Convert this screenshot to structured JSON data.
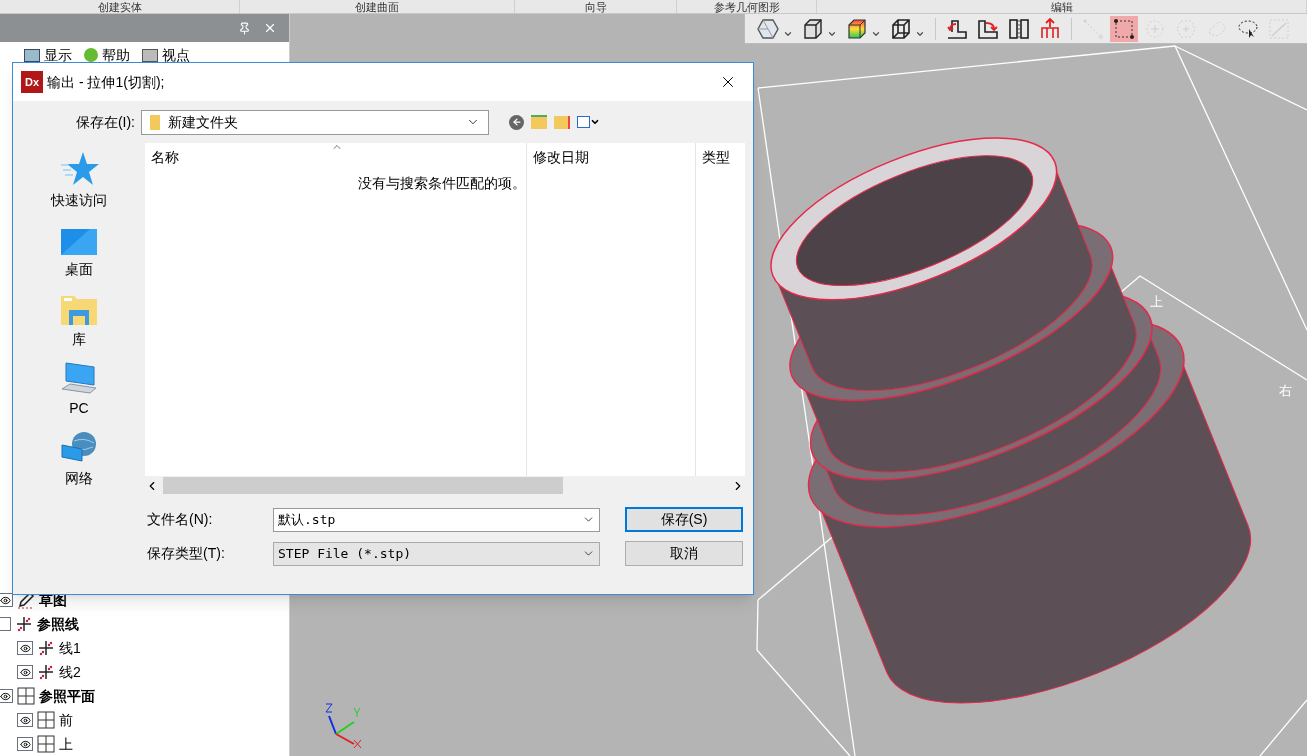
{
  "ribbon_groups": [
    "创建实体",
    "创建曲面",
    "向导",
    "参考几何图形",
    "编辑"
  ],
  "left_panel": {
    "toolbar": [
      {
        "label": "显示",
        "kind": "display"
      },
      {
        "label": "帮助",
        "kind": "help"
      },
      {
        "label": "视点",
        "kind": "view"
      }
    ],
    "tree": [
      {
        "label": "草图",
        "kind": "sketch",
        "visible": true
      },
      {
        "label": "参照线",
        "kind": "line",
        "visible": false,
        "children": [
          {
            "label": "线1",
            "kind": "line",
            "visible": true
          },
          {
            "label": "线2",
            "kind": "line",
            "visible": true
          }
        ]
      },
      {
        "label": "参照平面",
        "kind": "plane",
        "visible": true,
        "children": [
          {
            "label": "前",
            "kind": "plane",
            "visible": true
          },
          {
            "label": "上",
            "kind": "plane",
            "visible": true
          }
        ]
      }
    ]
  },
  "viewport_toolbar": [
    {
      "kind": "shape",
      "dropdown": true,
      "selected": false,
      "disabled": false
    },
    {
      "kind": "cube",
      "dropdown": true,
      "selected": false,
      "disabled": false
    },
    {
      "kind": "colorcube",
      "dropdown": true,
      "selected": false,
      "disabled": false
    },
    {
      "kind": "wirebox",
      "dropdown": true,
      "selected": false,
      "disabled": false
    },
    {
      "kind": "rotleft",
      "dropdown": false,
      "selected": false,
      "disabled": false
    },
    {
      "kind": "rotright",
      "dropdown": false,
      "selected": false,
      "disabled": false
    },
    {
      "kind": "split",
      "dropdown": false,
      "selected": false,
      "disabled": false
    },
    {
      "kind": "lift",
      "dropdown": false,
      "selected": false,
      "disabled": false
    },
    {
      "kind": "line",
      "dropdown": false,
      "selected": false,
      "disabled": true
    },
    {
      "kind": "rect",
      "dropdown": false,
      "selected": true,
      "disabled": false
    },
    {
      "kind": "circle",
      "dropdown": false,
      "selected": false,
      "disabled": true
    },
    {
      "kind": "hex",
      "dropdown": false,
      "selected": false,
      "disabled": true
    },
    {
      "kind": "blob",
      "dropdown": false,
      "selected": false,
      "disabled": true
    },
    {
      "kind": "lasso",
      "dropdown": false,
      "selected": false,
      "disabled": false
    },
    {
      "kind": "graph",
      "dropdown": false,
      "selected": false,
      "disabled": true
    }
  ],
  "viewport_labels": [
    "上",
    "右"
  ],
  "dialog": {
    "app_logo": "Dx",
    "title": "输出 - 拉伸1(切割);",
    "save_in_label": "保存在(I):",
    "folder": "新建文件夹",
    "places": [
      {
        "label": "快速访问",
        "kind": "star"
      },
      {
        "label": "桌面",
        "kind": "desktop"
      },
      {
        "label": "库",
        "kind": "library"
      },
      {
        "label": "PC",
        "kind": "pc"
      },
      {
        "label": "网络",
        "kind": "network"
      }
    ],
    "columns": [
      "名称",
      "修改日期",
      "类型"
    ],
    "empty_message": "没有与搜索条件匹配的项。",
    "filename_label": "文件名(N):",
    "filename": "默认.stp",
    "type_label": "保存类型(T):",
    "type": "STEP File (*.stp)",
    "buttons": [
      {
        "label": "保存(S)",
        "default": true
      },
      {
        "label": "取消",
        "default": false
      }
    ]
  }
}
